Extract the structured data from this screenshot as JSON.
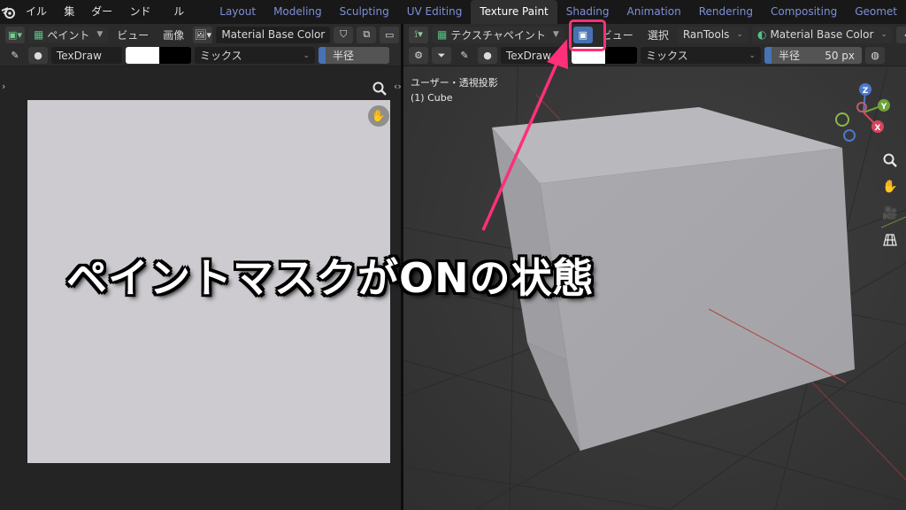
{
  "menubar": {
    "menus": [
      "ファイル",
      "編集",
      "レンダー",
      "ウィンドウ",
      "ヘルプ"
    ],
    "workspaces": [
      "Layout",
      "Modeling",
      "Sculpting",
      "UV Editing",
      "Texture Paint",
      "Shading",
      "Animation",
      "Rendering",
      "Compositing",
      "Geomet"
    ],
    "active_workspace": "Texture Paint"
  },
  "left": {
    "mode": "ペイント",
    "view_menu": "ビュー",
    "image_menu": "画像",
    "image_name": "Material Base Color",
    "brush": "TexDraw",
    "blend": "ミックス",
    "radius_label": "半径"
  },
  "right": {
    "mode": "テクスチャペイント",
    "view_menu": "ビュー",
    "select_menu": "選択",
    "addon": "RanTools",
    "material": "Material Base Color",
    "brush": "TexDraw",
    "blend": "ミックス",
    "radius_label": "半径",
    "radius_value": "50 px",
    "viewport_label": "ユーザー・透視投影",
    "object_label": "(1) Cube",
    "gizmo_axes": [
      "Z",
      "Y",
      "X"
    ]
  },
  "annotation": {
    "caption": "ペイントマスクがONの状態",
    "highlight_color": "#ff2f7a"
  }
}
